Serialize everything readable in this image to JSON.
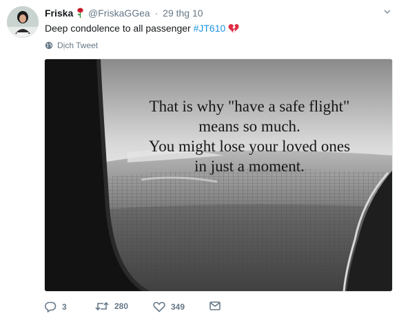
{
  "tweet": {
    "author_name": "Friska",
    "handle": "@FriskaGGea",
    "separator": "·",
    "time": "29 thg 10",
    "text": "Deep condolence to all passenger ",
    "hashtag": "#JT610",
    "translate_label": "Dịch Tweet"
  },
  "image": {
    "quote_lines": [
      "That is why \"have a safe flight\"",
      "means so much.",
      "You might lose your loved ones",
      "in just a moment."
    ]
  },
  "actions": {
    "reply_count": "3",
    "retweet_count": "280",
    "like_count": "349"
  },
  "icons": {
    "caret": "chevron-down-icon",
    "rose": "rose-emoji",
    "heart": "broken-heart-emoji",
    "globe": "globe-icon",
    "reply": "reply-icon",
    "retweet": "retweet-icon",
    "like": "like-icon",
    "message": "direct-message-icon"
  },
  "colors": {
    "link": "#1b95e0",
    "secondary": "#657786"
  }
}
